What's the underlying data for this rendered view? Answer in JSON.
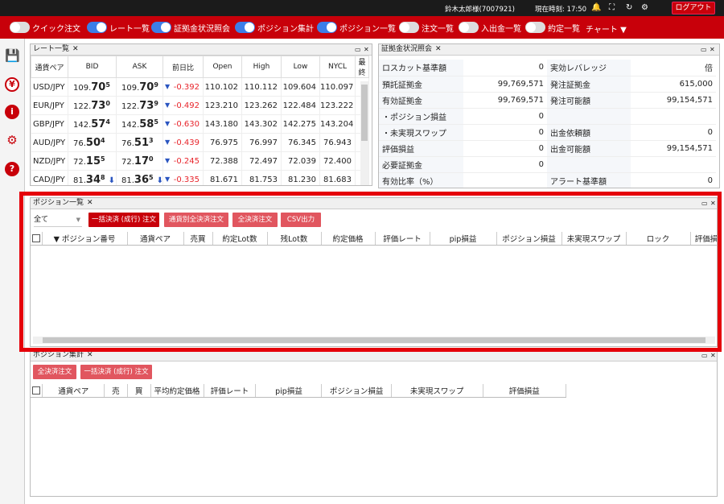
{
  "header": {
    "user": "鈴木太郎様(7007921)",
    "time": "現在時刻: 17:50",
    "logout": "ログアウト"
  },
  "toolbar": {
    "toggles": [
      {
        "label": "クイック注文",
        "on": false
      },
      {
        "label": "レート一覧",
        "on": true
      },
      {
        "label": "証拠金状況照会",
        "on": true
      },
      {
        "label": "ポジション集計",
        "on": true
      },
      {
        "label": "ポジション一覧",
        "on": true
      },
      {
        "label": "注文一覧",
        "on": false
      },
      {
        "label": "入出金一覧",
        "on": false
      },
      {
        "label": "約定一覧",
        "on": false
      }
    ],
    "chart": "チャート ▼"
  },
  "rates": {
    "title": "レート一覧",
    "close": "✕",
    "headers": [
      "通貨ペア",
      "BID",
      "ASK",
      "前日比",
      "Open",
      "High",
      "Low",
      "NYCL",
      "最終"
    ],
    "rows": [
      {
        "pair": "USD/JPY",
        "bid_a": "109.",
        "bid_b": "70",
        "bid_c": "5",
        "ask_a": "109.",
        "ask_b": "70",
        "ask_c": "9",
        "arrow": "",
        "change": "-0.392",
        "open": "110.102",
        "high": "110.112",
        "low": "109.604",
        "nycl": "110.097"
      },
      {
        "pair": "EUR/JPY",
        "bid_a": "122.",
        "bid_b": "73",
        "bid_c": "0",
        "ask_a": "122.",
        "ask_b": "73",
        "ask_c": "9",
        "arrow": "",
        "change": "-0.492",
        "open": "123.210",
        "high": "123.262",
        "low": "122.484",
        "nycl": "123.222"
      },
      {
        "pair": "GBP/JPY",
        "bid_a": "142.",
        "bid_b": "57",
        "bid_c": "4",
        "ask_a": "142.",
        "ask_b": "58",
        "ask_c": "5",
        "arrow": "",
        "change": "-0.630",
        "open": "143.180",
        "high": "143.302",
        "low": "142.275",
        "nycl": "143.204"
      },
      {
        "pair": "AUD/JPY",
        "bid_a": "76.",
        "bid_b": "50",
        "bid_c": "4",
        "ask_a": "76.",
        "ask_b": "51",
        "ask_c": "3",
        "arrow": "",
        "change": "-0.439",
        "open": "76.975",
        "high": "76.997",
        "low": "76.345",
        "nycl": "76.943"
      },
      {
        "pair": "NZD/JPY",
        "bid_a": "72.",
        "bid_b": "15",
        "bid_c": "5",
        "ask_a": "72.",
        "ask_b": "17",
        "ask_c": "0",
        "arrow": "",
        "change": "-0.245",
        "open": "72.388",
        "high": "72.497",
        "low": "72.039",
        "nycl": "72.400"
      },
      {
        "pair": "CAD/JPY",
        "bid_a": "81.",
        "bid_b": "34",
        "bid_c": "8",
        "ask_a": "81.",
        "ask_b": "36",
        "ask_c": "5",
        "arrow": "⬇",
        "change": "-0.335",
        "open": "81.671",
        "high": "81.753",
        "low": "81.230",
        "nycl": "81.683"
      }
    ]
  },
  "margin": {
    "title": "証拠金状況照会",
    "close": "✕",
    "rows": [
      {
        "l1": "ロスカット基準額",
        "v1": "0",
        "l2": "実効レバレッジ",
        "v2": "倍"
      },
      {
        "l1": "預託証拠金",
        "v1": "99,769,571",
        "l2": "発注証拠金",
        "v2": "615,000"
      },
      {
        "l1": "有効証拠金",
        "v1": "99,769,571",
        "l2": "発注可能額",
        "v2": "99,154,571"
      },
      {
        "l1": "・ポジション損益",
        "v1": "0",
        "l2": "",
        "v2": ""
      },
      {
        "l1": "・未実現スワップ",
        "v1": "0",
        "l2": "出金依頼額",
        "v2": "0"
      },
      {
        "l1": "評価損益",
        "v1": "0",
        "l2": "出金可能額",
        "v2": "99,154,571"
      },
      {
        "l1": "必要証拠金",
        "v1": "0",
        "l2": "",
        "v2": ""
      },
      {
        "l1": "有効比率（%）",
        "v1": "",
        "l2": "アラート基準額",
        "v2": "0"
      }
    ]
  },
  "positions": {
    "title": "ポジション一覧",
    "close": "✕",
    "filter": "全て",
    "buttons": [
      "一括決済 (成行) 注文",
      "通貨別全決済注文",
      "全決済注文",
      "CSV出力"
    ],
    "headers": [
      "▼ ポジション番号",
      "通貨ペア",
      "売買",
      "約定Lot数",
      "残Lot数",
      "約定価格",
      "評価レート",
      "pip損益",
      "ポジション損益",
      "未実現スワップ",
      "ロック",
      "評価損"
    ]
  },
  "summary": {
    "title": "ポジション集計",
    "close": "✕",
    "buttons": [
      "全決済注文",
      "一括決済 (成行) 注文"
    ],
    "headers": [
      "通貨ペア",
      "売",
      "買",
      "平均約定価格",
      "評価レート",
      "pip損益",
      "ポジション損益",
      "未実現スワップ",
      "評価損益"
    ]
  }
}
